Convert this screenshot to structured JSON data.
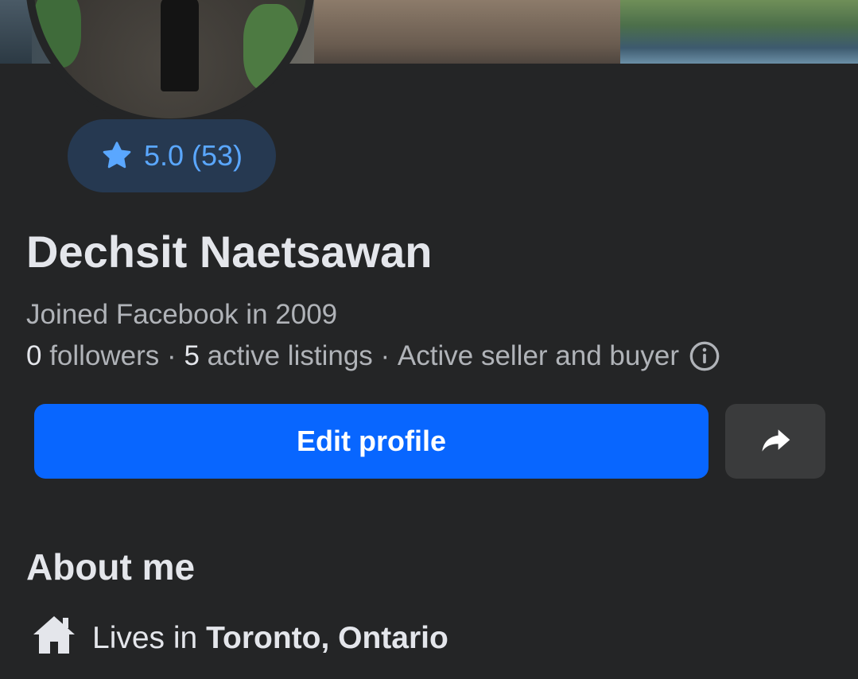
{
  "profile": {
    "name": "Dechsit Naetsawan",
    "joined": "Joined Facebook in 2009",
    "rating": "5.0 (53)",
    "followers_count": "0",
    "followers_label": "followers",
    "separator": "·",
    "listings_count": "5",
    "listings_label": "active listings",
    "status": "Active seller and buyer"
  },
  "actions": {
    "edit_label": "Edit profile"
  },
  "about": {
    "title": "About me",
    "lives_prefix": "Lives in",
    "location": "Toronto, Ontario"
  },
  "colors": {
    "background": "#242526",
    "primary_button": "#0866ff",
    "rating_pill": "#263951",
    "rating_text": "#5aa7ff",
    "secondary_button": "#3a3b3c"
  },
  "icons": {
    "rating": "star-icon",
    "info": "info-icon",
    "share": "share-arrow-icon",
    "home": "home-icon"
  }
}
